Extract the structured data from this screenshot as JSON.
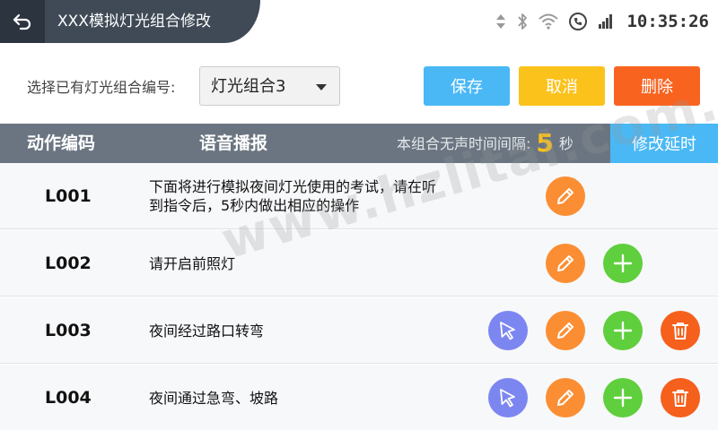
{
  "topbar": {
    "title": "XXX模拟灯光组合修改",
    "clock": "10:35:26",
    "status_icons": [
      "data-arrows-icon",
      "bluetooth-icon",
      "wifi-icon",
      "phone-icon",
      "signal-icon"
    ]
  },
  "controls": {
    "select_label": "选择已有灯光组合编号:",
    "select_value": "灯光组合3",
    "save_label": "保存",
    "cancel_label": "取消",
    "delete_label": "删除"
  },
  "table": {
    "header": {
      "code": "动作编码",
      "voice": "语音播报",
      "interval_label": "本组合无声时间间隔:",
      "interval_value": "5",
      "interval_unit": "秒",
      "modify_delay": "修改延时"
    },
    "rows": [
      {
        "code": "L001",
        "text": "下面将进行模拟夜间灯光使用的考试，请在听到指令后，5秒内做出相应的操作"
      },
      {
        "code": "L002",
        "text": "请开启前照灯"
      },
      {
        "code": "L003",
        "text": "夜间经过路口转弯"
      },
      {
        "code": "L004",
        "text": "夜间通过急弯、坡路"
      }
    ]
  },
  "watermark": "www.hzlitai.com.cn",
  "colors": {
    "header_dark": "#3f4a56",
    "table_header": "#6a7581",
    "blue": "#4ab8f5",
    "yellow": "#fbc21b",
    "orange_red": "#f86420",
    "edit_orange": "#fb8e33",
    "add_green": "#5fcf3d",
    "cursor_purple": "#7c86f1"
  }
}
